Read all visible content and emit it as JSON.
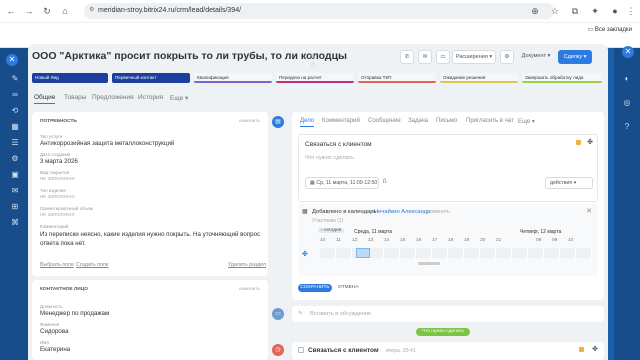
{
  "browser": {
    "url": "meridian-stroy.bitrix24.ru/crm/lead/details/394/",
    "bookmarks_label": "Все закладки"
  },
  "lead": {
    "title": "ООО \"Арктика\" просит покрыть то ли трубы, то ли колодцы",
    "buttons": {
      "extensions": "Расширения",
      "document": "Документ",
      "deal": "Сделку"
    }
  },
  "stages": [
    {
      "label": "Новый Лид",
      "state": "done",
      "color": "#1c3f9e"
    },
    {
      "label": "Первичный контакт",
      "state": "current",
      "color": "#1c3f9e"
    },
    {
      "label": "Квалификация",
      "state": "todo",
      "color": "#7d63d3"
    },
    {
      "label": "Передача на расчет",
      "state": "todo",
      "color": "#c22e7a"
    },
    {
      "label": "Отправка ТКП",
      "state": "todo",
      "color": "#e2655a"
    },
    {
      "label": "Ожидание решения",
      "state": "todo",
      "color": "#d9c84a"
    },
    {
      "label": "Завершить обработку лида",
      "state": "todo",
      "color": "#9fcf4b"
    }
  ],
  "tabs": [
    "Общие",
    "Товары",
    "Предложения",
    "История",
    "Еще"
  ],
  "need": {
    "title": "ПОТРЕБНОСТЬ",
    "action": "изменить",
    "fields": [
      {
        "label": "Тип услуги",
        "value": "Антикоррозийная защита металлоконструкций",
        "empty": false
      },
      {
        "label": "Дата создания",
        "value": "3 марта 2026",
        "empty": false
      },
      {
        "label": "Вид покрытия",
        "value": "не заполнено",
        "empty": true
      },
      {
        "label": "Тип изделия",
        "value": "не заполнено",
        "empty": true
      },
      {
        "label": "Ориентировочный объем",
        "value": "не заполнено",
        "empty": true
      }
    ],
    "comment_label": "Комментарий",
    "comment_text": "Из переписки неясно, какие изделия нужно покрыть. На уточняющий вопрос ответа пока нет.",
    "choose_field": "Выбрать поле",
    "create_field": "Создать поле",
    "delete_section": "Удалить раздел"
  },
  "contact": {
    "title": "КОНТАКТНОЕ ЛИЦО",
    "action": "изменить",
    "fields": [
      {
        "label": "Должность",
        "value": "Менеджер по продажам"
      },
      {
        "label": "Фамилия",
        "value": "Сидорова"
      },
      {
        "label": "Имя",
        "value": "Екатерина"
      }
    ]
  },
  "timeline": {
    "tabs": [
      "Дело",
      "Комментарий",
      "Сообщение",
      "Задача",
      "Письмо",
      "Пригласить в чат",
      "Еще"
    ],
    "todo_title": "Связаться с клиентом",
    "todo_placeholder": "Что нужно сделать",
    "todo_date": "Ср, 11 марта, 11:00-12:50",
    "actions_label": "действия",
    "calendar_added": "Добавлено в календарь",
    "calendar_user": "Нечайкин Александр",
    "calendar_change": "изменить",
    "participants": "Участники (1)",
    "today_label": "сегодня",
    "today_date": "Среда, 11 марта",
    "next_date": "Четверг, 12 марта",
    "hours": [
      "10",
      "11",
      "12",
      "13",
      "14",
      "15",
      "16",
      "17",
      "18",
      "19",
      "20",
      "21",
      "08",
      "09",
      "10"
    ],
    "save": "СОХРАНИТЬ",
    "cancel": "ОТМЕНА",
    "comment_placeholder": "Вставить в обсуждение",
    "todo_badge": "Что нужно сделать",
    "item_title": "Связаться с клиентом",
    "item_time": "вчера, 20:41"
  }
}
